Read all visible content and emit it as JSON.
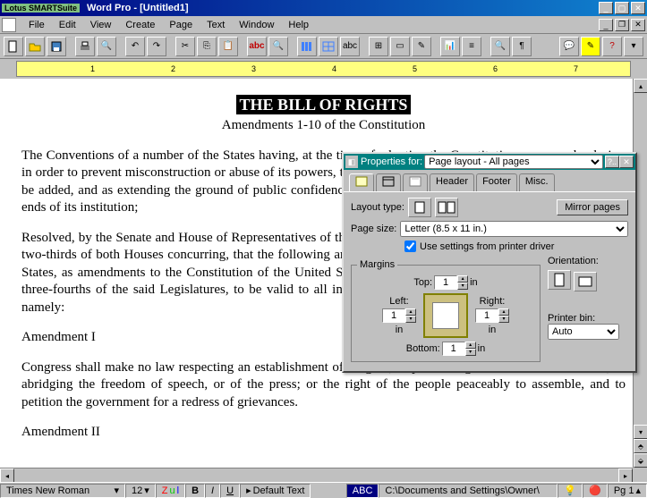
{
  "titlebar": {
    "suite": "Lotus",
    "smart": "SMART",
    "suite2": "Suite",
    "app": "Word Pro",
    "doc": "[Untitled1]"
  },
  "menu": {
    "file": "File",
    "edit": "Edit",
    "view": "View",
    "create": "Create",
    "page": "Page",
    "text": "Text",
    "window": "Window",
    "help": "Help"
  },
  "document": {
    "title": "THE BILL OF RIGHTS",
    "subtitle": "Amendments 1-10 of the Constitution",
    "p1": "The Conventions of a number of the States having, at the time of adopting the Constitution, expressed a desire, in order to prevent misconstruction or abuse of its powers, that further declaratory and restrictive clauses should be added, and as extending the ground of public confidence in the Government will best insure the beneficent ends of its institution;",
    "p2": "Resolved, by the Senate and House of Representatives of the United States of America, in Congress assembled, two-thirds of both Houses concurring, that the following articles be proposed to the Legislatures of the several States, as amendments to the Constitution of the United States; all or any of which articles, when ratified by three-fourths of the said Legislatures, to be valid to all intents and purposes as part of the said Constitution, namely:",
    "a1h": "Amendment I",
    "a1": "Congress shall make no law respecting an establishment of religion, or prohibiting the free exercise thereof; or abridging the freedom of speech, or of the press; or the right of the people peaceably to assemble, and to petition the government for a redress of grievances.",
    "a2h": "Amendment II"
  },
  "ruler": {
    "marks": [
      "1",
      "2",
      "3",
      "4",
      "5",
      "6",
      "7"
    ]
  },
  "dialog": {
    "title_prefix": "Properties for:",
    "title_value": "Page layout - All pages",
    "help": "?..",
    "tabs": {
      "header": "Header",
      "footer": "Footer",
      "misc": "Misc."
    },
    "layout_type": "Layout type:",
    "mirror": "Mirror pages",
    "page_size": "Page size:",
    "page_size_val": "Letter (8.5 x 11 in.)",
    "use_printer": "Use settings from printer driver",
    "margins": "Margins",
    "top": "Top:",
    "left": "Left:",
    "right": "Right:",
    "bottom": "Bottom:",
    "unit": "in",
    "val_top": "1",
    "val_left": "1",
    "val_right": "1",
    "val_bottom": "1",
    "orientation": "Orientation:",
    "printer_bin": "Printer bin:",
    "bin_val": "Auto"
  },
  "status": {
    "font": "Times New Roman",
    "size": "12",
    "style": "Default Text",
    "path": "C:\\Documents and Settings\\Owner\\",
    "page": "Pg 1"
  }
}
